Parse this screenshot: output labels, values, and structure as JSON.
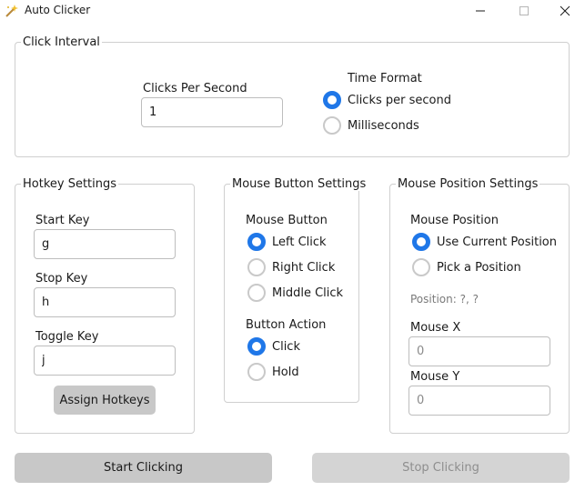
{
  "window": {
    "title": "Auto Clicker"
  },
  "click_interval": {
    "legend": "Click Interval",
    "cps_label": "Clicks Per Second",
    "cps_value": "1",
    "time_format_label": "Time Format",
    "time_format_options": [
      "Clicks per second",
      "Milliseconds"
    ],
    "time_format_selected": "Clicks per second"
  },
  "hotkeys": {
    "legend": "Hotkey Settings",
    "start_label": "Start Key",
    "start_value": "g",
    "stop_label": "Stop Key",
    "stop_value": "h",
    "toggle_label": "Toggle Key",
    "toggle_value": "j",
    "assign_label": "Assign Hotkeys"
  },
  "mouse_button": {
    "legend": "Mouse Button Settings",
    "button_label": "Mouse Button",
    "button_options": [
      "Left Click",
      "Right Click",
      "Middle Click"
    ],
    "button_selected": "Left Click",
    "action_label": "Button Action",
    "action_options": [
      "Click",
      "Hold"
    ],
    "action_selected": "Click"
  },
  "mouse_position": {
    "legend": "Mouse Position Settings",
    "position_label": "Mouse Position",
    "position_options": [
      "Use Current Position",
      "Pick a Position"
    ],
    "position_selected": "Use Current Position",
    "position_readout": "Position: ?, ?",
    "x_label": "Mouse X",
    "x_value": "0",
    "y_label": "Mouse Y",
    "y_value": "0"
  },
  "actions": {
    "start_label": "Start Clicking",
    "stop_label": "Stop Clicking"
  },
  "colors": {
    "accent": "#1f77e8",
    "button_bg": "#c8c8c8",
    "border": "#cfcfcf"
  }
}
